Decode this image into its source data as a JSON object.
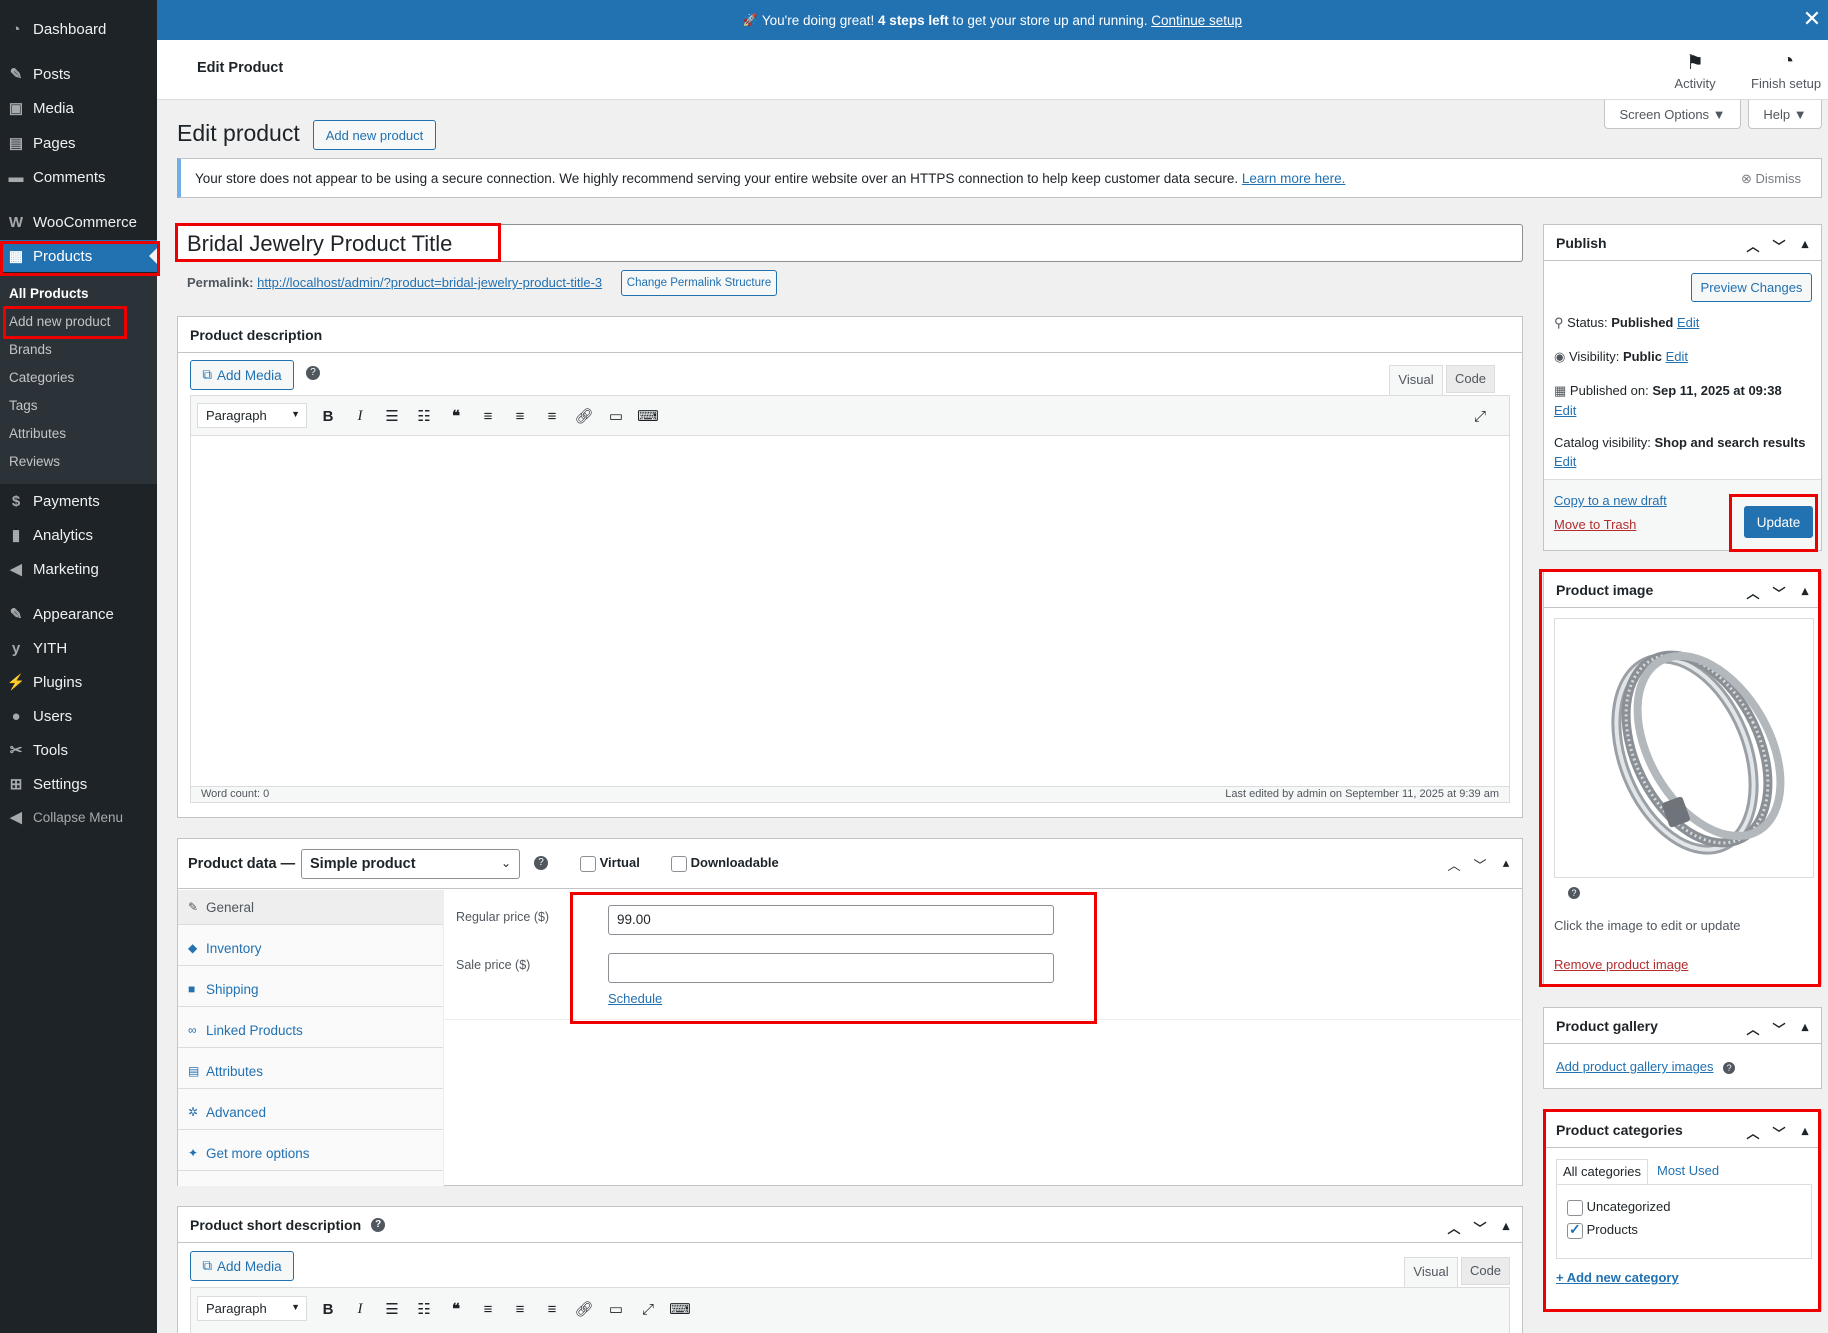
{
  "sidebar": {
    "items": [
      {
        "label": "Dashboard",
        "icon": "dashboard-icon",
        "glyph": "◔"
      },
      {
        "label": "Posts",
        "icon": "pin-icon",
        "glyph": "✎"
      },
      {
        "label": "Media",
        "icon": "media-icon",
        "glyph": "▣"
      },
      {
        "label": "Pages",
        "icon": "pages-icon",
        "glyph": "▤"
      },
      {
        "label": "Comments",
        "icon": "comment-icon",
        "glyph": "▬"
      },
      {
        "label": "WooCommerce",
        "icon": "woo-icon",
        "glyph": "W"
      },
      {
        "label": "Products",
        "icon": "products-icon",
        "glyph": "▦"
      },
      {
        "label": "Payments",
        "icon": "payments-icon",
        "glyph": "$"
      },
      {
        "label": "Analytics",
        "icon": "analytics-icon",
        "glyph": "▮"
      },
      {
        "label": "Marketing",
        "icon": "megaphone-icon",
        "glyph": "◀"
      },
      {
        "label": "Appearance",
        "icon": "brush-icon",
        "glyph": "✎"
      },
      {
        "label": "YITH",
        "icon": "yith-icon",
        "glyph": "y"
      },
      {
        "label": "Plugins",
        "icon": "plugin-icon",
        "glyph": "⚡"
      },
      {
        "label": "Users",
        "icon": "user-icon",
        "glyph": "●"
      },
      {
        "label": "Tools",
        "icon": "wrench-icon",
        "glyph": "✂"
      },
      {
        "label": "Settings",
        "icon": "settings-icon",
        "glyph": "⊞"
      },
      {
        "label": "Collapse Menu",
        "icon": "collapse-icon",
        "glyph": "◀"
      }
    ],
    "submenu": [
      "All Products",
      "Add new product",
      "Brands",
      "Categories",
      "Tags",
      "Attributes",
      "Reviews"
    ]
  },
  "banner": {
    "icon": "🚀",
    "before": "You're doing great!",
    "bold": "4 steps left",
    "after": "to get your store up and running.",
    "link": "Continue setup",
    "close": "✕"
  },
  "header": {
    "title": "Edit Product",
    "activity": "Activity",
    "finish": "Finish setup"
  },
  "page": {
    "heading": "Edit product",
    "add_new": "Add new product",
    "screen_options": "Screen Options ▼",
    "help": "Help ▼"
  },
  "notice": {
    "text": "Your store does not appear to be using a secure connection. We highly recommend serving your entire website over an HTTPS connection to help keep customer data secure.",
    "link": "Learn more here.",
    "dismiss": "Dismiss"
  },
  "product": {
    "title": "Bridal Jewelry Product Title",
    "permalink_label": "Permalink:",
    "permalink_url": "http://localhost/admin/?product=bridal-jewelry-product-title-3",
    "change_permalink": "Change Permalink Structure"
  },
  "description": {
    "heading": "Product description",
    "add_media": "Add Media",
    "tab_visual": "Visual",
    "tab_code": "Code",
    "format": "Paragraph",
    "word_count": "Word count: 0",
    "last_edited": "Last edited by admin on September 11, 2025 at 9:39 am"
  },
  "product_data": {
    "label": "Product data —",
    "type": "Simple product",
    "virtual": "Virtual",
    "downloadable": "Downloadable",
    "tabs": [
      "General",
      "Inventory",
      "Shipping",
      "Linked Products",
      "Attributes",
      "Advanced",
      "Get more options"
    ],
    "regular_price_label": "Regular price ($)",
    "regular_price": "99.00",
    "sale_price_label": "Sale price ($)",
    "sale_price": "",
    "schedule": "Schedule"
  },
  "short_description": {
    "heading": "Product short description",
    "add_media": "Add Media",
    "tab_visual": "Visual",
    "tab_code": "Code",
    "format": "Paragraph"
  },
  "publish": {
    "heading": "Publish",
    "preview": "Preview Changes",
    "status_label": "Status:",
    "status_value": "Published",
    "visibility_label": "Visibility:",
    "visibility_value": "Public",
    "published_label": "Published on:",
    "published_value": "Sep 11, 2025 at 09:38",
    "catalog_label": "Catalog visibility:",
    "catalog_value": "Shop and search results",
    "edit": "Edit",
    "copy_draft": "Copy to a new draft",
    "trash": "Move to Trash",
    "update": "Update"
  },
  "product_image": {
    "heading": "Product image",
    "hint": "Click the image to edit or update",
    "remove": "Remove product image"
  },
  "gallery": {
    "heading": "Product gallery",
    "add": "Add product gallery images"
  },
  "categories": {
    "heading": "Product categories",
    "tab_all": "All categories",
    "tab_used": "Most Used",
    "items": [
      {
        "label": "Uncategorized",
        "checked": false
      },
      {
        "label": "Products",
        "checked": true
      }
    ],
    "add_new": "+ Add new category"
  },
  "colors": {
    "sidebar": "#1d2327",
    "accent": "#2271b1",
    "highlight_border": "#e00000"
  }
}
